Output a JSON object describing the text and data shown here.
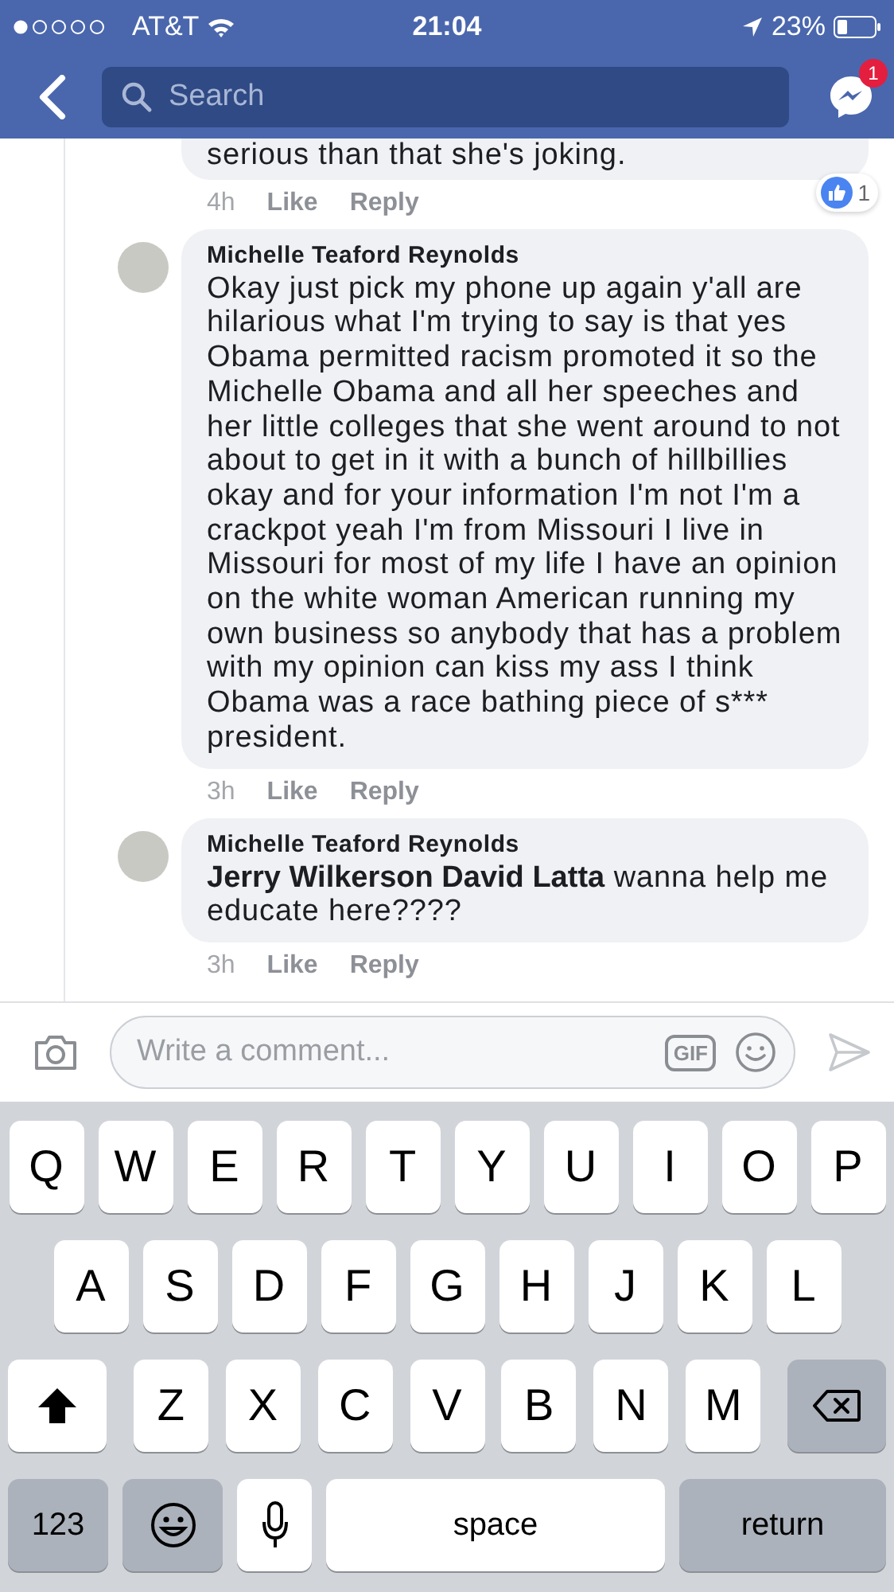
{
  "status_bar": {
    "carrier": "AT&T",
    "time": "21:04",
    "battery": "23%"
  },
  "nav": {
    "search": {
      "placeholder": "Search"
    },
    "messenger_badge": "1"
  },
  "comments": [
    {
      "kind": "partial",
      "text": "serious than that she's joking.",
      "time": "4h",
      "like": "Like",
      "reply": "Reply",
      "reactions": "1"
    },
    {
      "kind": "full",
      "author": "Michelle Teaford Reynolds",
      "text": "Okay just pick my phone up again y'all are hilarious what I'm trying to say is that yes Obama permitted racism promoted it so the Michelle Obama and all her speeches and her little colleges that she went around to not about to get in it with a bunch of hillbillies okay and for your information I'm not I'm a crackpot yeah I'm from Missouri I live in Missouri for most of my life I have an opinion on the white woman American running my own business so anybody that has a problem with my opinion can kiss my ass I think Obama was a race bathing piece of s*** president.",
      "time": "3h",
      "like": "Like",
      "reply": "Reply"
    },
    {
      "kind": "full",
      "author": "Michelle Teaford Reynolds",
      "text": "**Jerry Wilkerson David Latta** wanna help me educate here????",
      "time": "3h",
      "like": "Like",
      "reply": "Reply"
    }
  ],
  "composer": {
    "placeholder": "Write a comment...",
    "gif_label": "GIF"
  },
  "keyboard": [
    [
      {
        "kind": "letter",
        "label": "Q"
      },
      {
        "kind": "letter",
        "label": "W"
      },
      {
        "kind": "letter",
        "label": "E"
      },
      {
        "kind": "letter",
        "label": "R"
      },
      {
        "kind": "letter",
        "label": "T"
      },
      {
        "kind": "letter",
        "label": "Y"
      },
      {
        "kind": "letter",
        "label": "U"
      },
      {
        "kind": "letter",
        "label": "I"
      },
      {
        "kind": "letter",
        "label": "O"
      },
      {
        "kind": "letter",
        "label": "P"
      }
    ],
    [
      {
        "kind": "letter",
        "label": "A"
      },
      {
        "kind": "letter",
        "label": "S"
      },
      {
        "kind": "letter",
        "label": "D"
      },
      {
        "kind": "letter",
        "label": "F"
      },
      {
        "kind": "letter",
        "label": "G"
      },
      {
        "kind": "letter",
        "label": "H"
      },
      {
        "kind": "letter",
        "label": "J"
      },
      {
        "kind": "letter",
        "label": "K"
      },
      {
        "kind": "letter",
        "label": "L"
      }
    ],
    [
      {
        "kind": "shift"
      },
      {
        "kind": "letter",
        "label": "Z"
      },
      {
        "kind": "letter",
        "label": "X"
      },
      {
        "kind": "letter",
        "label": "C"
      },
      {
        "kind": "letter",
        "label": "V"
      },
      {
        "kind": "letter",
        "label": "B"
      },
      {
        "kind": "letter",
        "label": "N"
      },
      {
        "kind": "letter",
        "label": "M"
      },
      {
        "kind": "backspace"
      }
    ],
    [
      {
        "kind": "mode",
        "label": "123"
      },
      {
        "kind": "emoji"
      },
      {
        "kind": "mic"
      },
      {
        "kind": "space",
        "label": "space"
      },
      {
        "kind": "return",
        "label": "return"
      }
    ]
  ]
}
